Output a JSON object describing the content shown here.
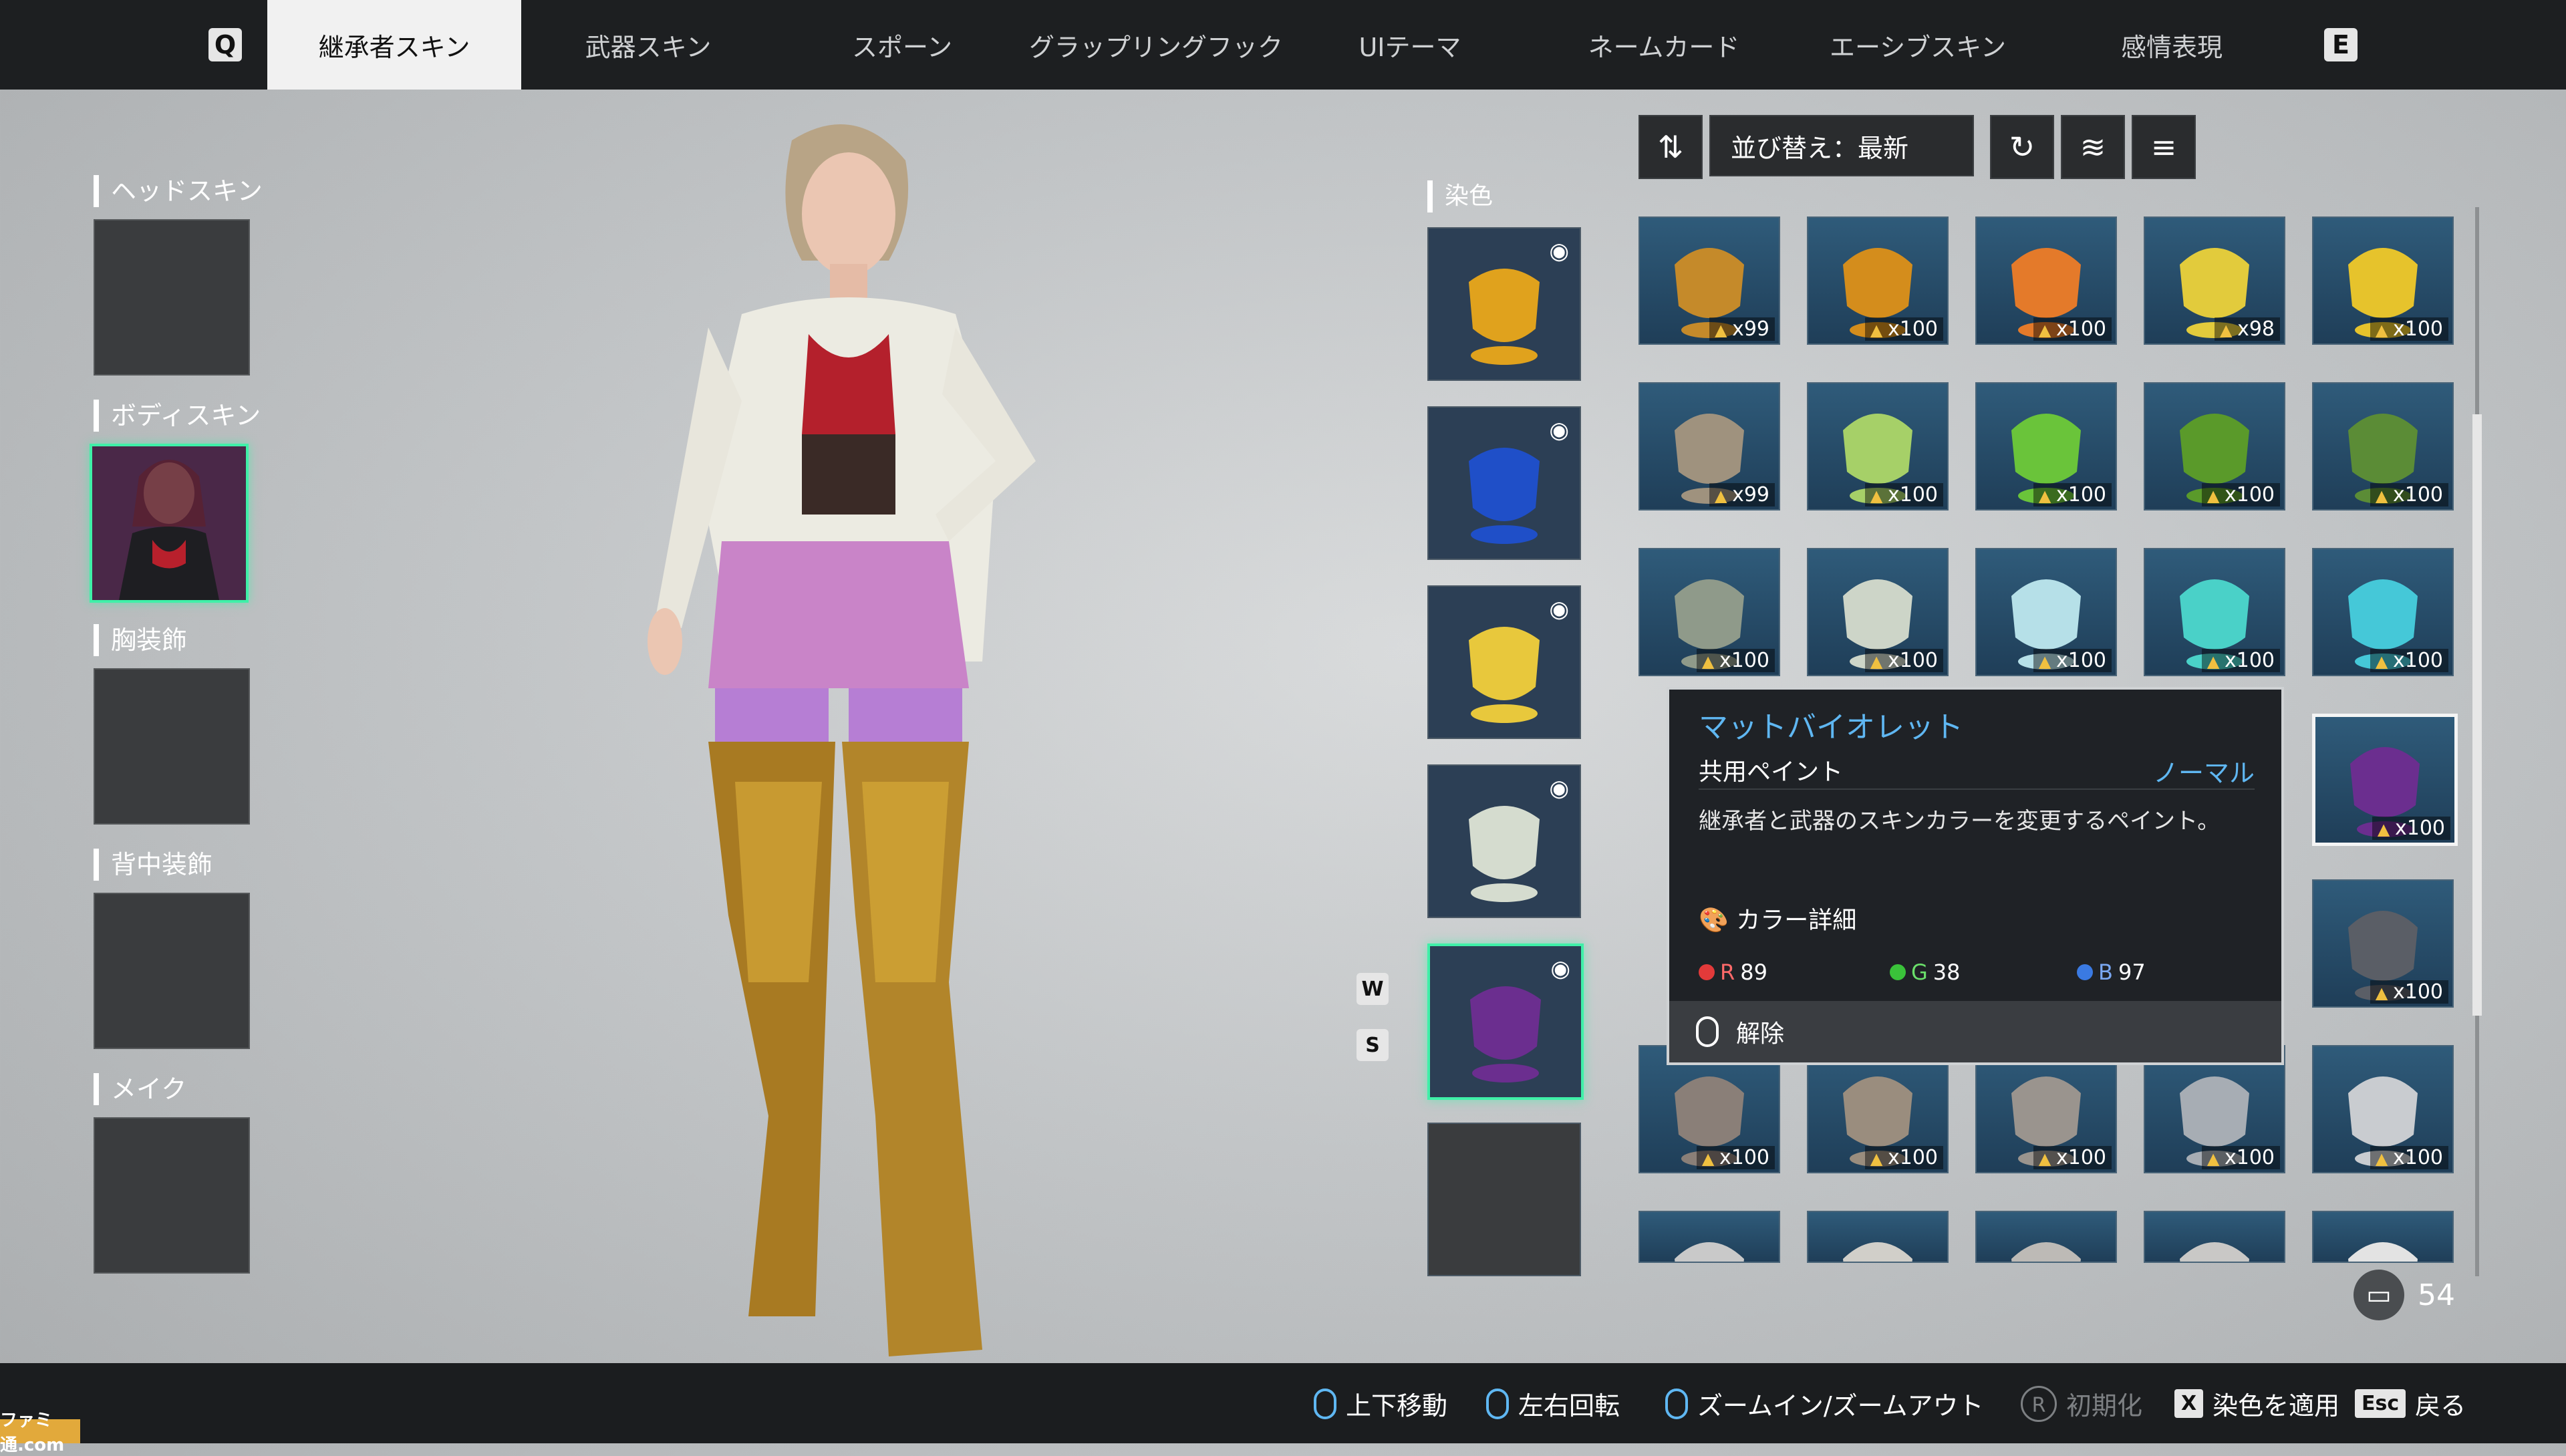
{
  "top_nav": {
    "left_key": "Q",
    "right_key": "E",
    "tabs": [
      {
        "label": "継承者スキン",
        "active": true
      },
      {
        "label": "武器スキン",
        "active": false
      },
      {
        "label": "スポーン",
        "active": false
      },
      {
        "label": "グラップリングフック",
        "active": false
      },
      {
        "label": "UIテーマ",
        "active": false
      },
      {
        "label": "ネームカード",
        "active": false
      },
      {
        "label": "エーシブスキン",
        "active": false
      },
      {
        "label": "感情表現",
        "active": false
      }
    ]
  },
  "slots": [
    {
      "label": "ヘッドスキン",
      "equipped": false
    },
    {
      "label": "ボディスキン",
      "equipped": true
    },
    {
      "label": "胸装飾",
      "equipped": false
    },
    {
      "label": "背中装飾",
      "equipped": false
    },
    {
      "label": "メイク",
      "equipped": false
    }
  ],
  "dye_panel": {
    "label": "染色",
    "key_up": "W",
    "key_down": "S",
    "slots": [
      {
        "color": "#e0a21d",
        "visible": true
      },
      {
        "color": "#1f4fc8",
        "visible": true
      },
      {
        "color": "#e8c83c",
        "visible": true
      },
      {
        "color": "#d5dccf",
        "visible": true
      },
      {
        "color": "#6b2e8f",
        "visible": true
      },
      {
        "color": "",
        "visible": false
      }
    ]
  },
  "toolbar": {
    "sort_icon": "sort-icon",
    "sort_label": "並び替え：最新",
    "reset_icon": "refresh-icon",
    "layers_icon": "layers-icon",
    "layers_alt_icon": "layers-stack-icon"
  },
  "grid": {
    "rows": [
      [
        {
          "color": "#c58a2a",
          "count": "x99"
        },
        {
          "color": "#d48d1c",
          "count": "x100"
        },
        {
          "color": "#e47a2a",
          "count": "x100"
        },
        {
          "color": "#e2cb3c",
          "count": "x98"
        },
        {
          "color": "#e6c32c",
          "count": "x100"
        }
      ],
      [
        {
          "color": "#9f927e",
          "count": "x99"
        },
        {
          "color": "#a6d068",
          "count": "x100"
        },
        {
          "color": "#6ac43a",
          "count": "x100"
        },
        {
          "color": "#5a9a2a",
          "count": "x100"
        },
        {
          "color": "#5b8c36",
          "count": "x100"
        }
      ],
      [
        {
          "color": "#8f9a8a",
          "count": "x100"
        },
        {
          "color": "#cdd5c8",
          "count": "x100"
        },
        {
          "color": "#b6e0e8",
          "count": "x100"
        },
        {
          "color": "#4ad1c8",
          "count": "x100"
        },
        {
          "color": "#45c8d8",
          "count": "x100"
        }
      ],
      [
        {
          "color": "",
          "count": ""
        },
        {
          "color": "",
          "count": ""
        },
        {
          "color": "",
          "count": ""
        },
        {
          "color": "",
          "count": ""
        },
        {
          "color": "#6b2e8f",
          "count": "x100",
          "selected": true
        }
      ],
      [
        {
          "color": "",
          "count": ""
        },
        {
          "color": "",
          "count": ""
        },
        {
          "color": "",
          "count": ""
        },
        {
          "color": "",
          "count": ""
        },
        {
          "color": "#5a5e66",
          "count": "x100"
        }
      ],
      [
        {
          "color": "#8a7f78",
          "count": "x100"
        },
        {
          "color": "#9a8d7e",
          "count": "x100"
        },
        {
          "color": "#9a948e",
          "count": "x100"
        },
        {
          "color": "#a7adb4",
          "count": "x100"
        },
        {
          "color": "#c9ccd0",
          "count": "x100"
        }
      ],
      [
        {
          "color": "#c9c9c9",
          "count": ""
        },
        {
          "color": "#d1cfc9",
          "count": ""
        },
        {
          "color": "#bdbab6",
          "count": ""
        },
        {
          "color": "#c9c8c6",
          "count": ""
        },
        {
          "color": "#e3e3e3",
          "count": ""
        }
      ]
    ]
  },
  "tooltip": {
    "title": "マットバイオレット",
    "subtitle": "共用ペイント",
    "rarity": "ノーマル",
    "description": "継承者と武器のスキンカラーを変更するペイント。",
    "color_detail_label": "カラー詳細",
    "rgb": [
      {
        "channel": "R",
        "value": "89",
        "color": "#e23a3a"
      },
      {
        "channel": "G",
        "value": "38",
        "color": "#3ac23a"
      },
      {
        "channel": "B",
        "value": "97",
        "color": "#3a7ae2"
      }
    ],
    "action_label": "解除"
  },
  "inventory_count": "54",
  "bottom_hints": [
    {
      "label": "上下移動",
      "dim": false
    },
    {
      "label": "左右回転",
      "dim": false
    },
    {
      "label": "ズームイン/ズームアウト",
      "dim": false
    },
    {
      "key": "R",
      "label": "初期化",
      "dim": true
    },
    {
      "key": "X",
      "label": "染色を適用",
      "dim": false
    },
    {
      "key": "Esc",
      "label": "戻る",
      "dim": false
    }
  ],
  "watermark": "ファミ通.com"
}
